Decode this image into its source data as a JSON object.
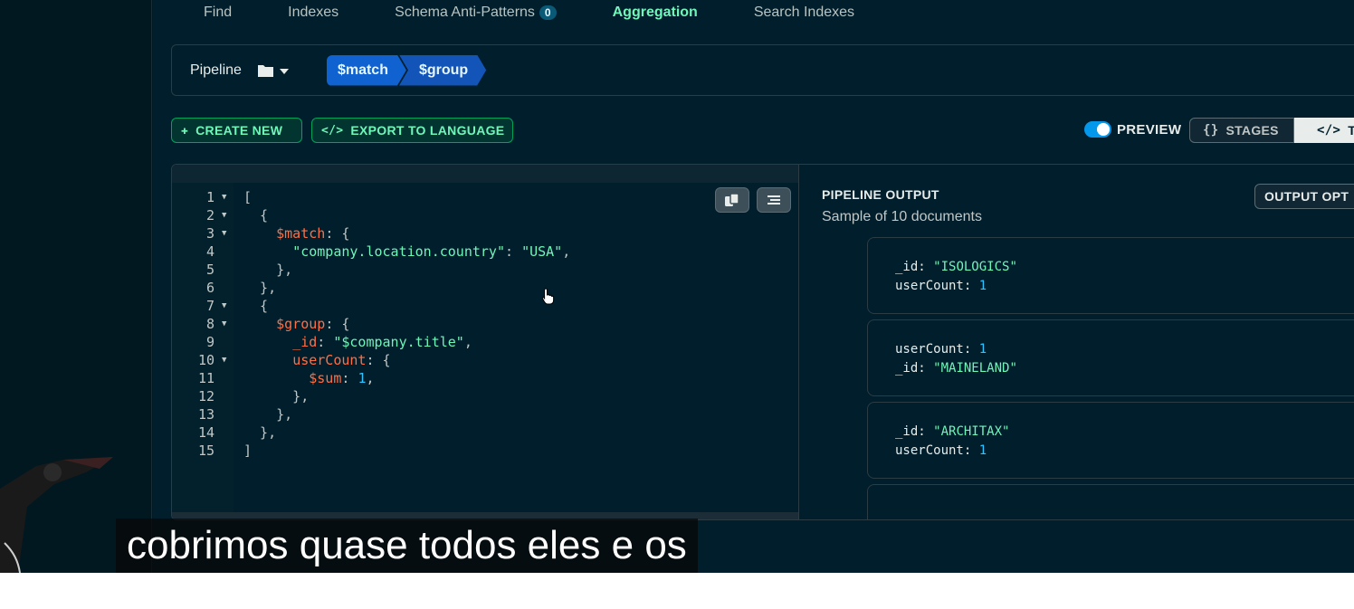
{
  "tabs": {
    "find": "Find",
    "indexes": "Indexes",
    "schema": "Schema Anti-Patterns",
    "schema_count": "0",
    "aggregation": "Aggregation",
    "search_indexes": "Search Indexes"
  },
  "pipeline": {
    "label": "Pipeline",
    "stages": [
      "$match",
      "$group"
    ]
  },
  "toolbar": {
    "create_new": "CREATE NEW",
    "export": "EXPORT TO LANGUAGE",
    "preview": "PREVIEW",
    "stages": "STAGES",
    "text_mode": "T",
    "preview_on": true
  },
  "editor": {
    "line_numbers": [
      "1",
      "2",
      "3",
      "4",
      "5",
      "6",
      "7",
      "8",
      "9",
      "10",
      "11",
      "12",
      "13",
      "14",
      "15"
    ]
  },
  "output": {
    "title": "PIPELINE OUTPUT",
    "subtitle": "Sample of 10 documents",
    "options": "OUTPUT OPT",
    "documents": [
      {
        "k1": "_id",
        "v1": "\"ISOLOGICS\"",
        "k2": "userCount",
        "v2": "1"
      },
      {
        "k1": "userCount",
        "v1": "1",
        "k2": "_id",
        "v2": "\"MAINELAND\""
      },
      {
        "k1": "_id",
        "v1": "\"ARCHITAX\"",
        "k2": "userCount",
        "v2": "1"
      }
    ]
  },
  "caption": "cobrimos quase todos eles e os",
  "colors": {
    "accent_green": "#71f6ba",
    "stage_blue": "#0f62cf",
    "background": "#001e2b"
  }
}
